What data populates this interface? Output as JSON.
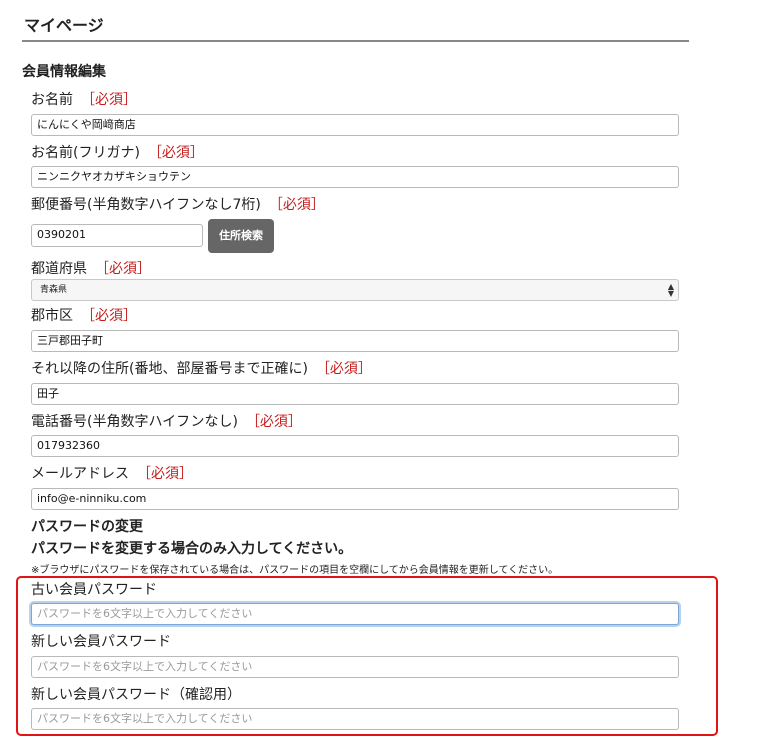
{
  "page": {
    "title": "マイページ"
  },
  "section": {
    "title": "会員情報編集"
  },
  "required_mark": "［必須］",
  "fields": {
    "name": {
      "label": "お名前",
      "value": "にんにくや岡﨑商店"
    },
    "kana": {
      "label": "お名前(フリガナ)",
      "value": "ニンニクヤオカザキショウテン"
    },
    "zip": {
      "label": "郵便番号(半角数字ハイフンなし7桁)",
      "value": "0390201",
      "button": "住所検索"
    },
    "prefecture": {
      "label": "都道府県",
      "selected": "青森県"
    },
    "city": {
      "label": "郡市区",
      "value": "三戸郡田子町"
    },
    "address": {
      "label": "それ以降の住所(番地、部屋番号まで正確に)",
      "value": "田子"
    },
    "phone": {
      "label": "電話番号(半角数字ハイフンなし)",
      "value": "017932360"
    },
    "email": {
      "label": "メールアドレス",
      "value": "info@e-ninniku.com"
    }
  },
  "password": {
    "heading": "パスワードの変更",
    "subheading": "パスワードを変更する場合のみ入力してください。",
    "note": "※ブラウザにパスワードを保存されている場合は、パスワードの項目を空欄にしてから会員情報を更新してください。",
    "old_label": "古い会員パスワード",
    "new_label": "新しい会員パスワード",
    "confirm_label": "新しい会員パスワード（確認用）",
    "placeholder": "パスワードを6文字以上で入力してください"
  },
  "highlight_color": "#e01414"
}
